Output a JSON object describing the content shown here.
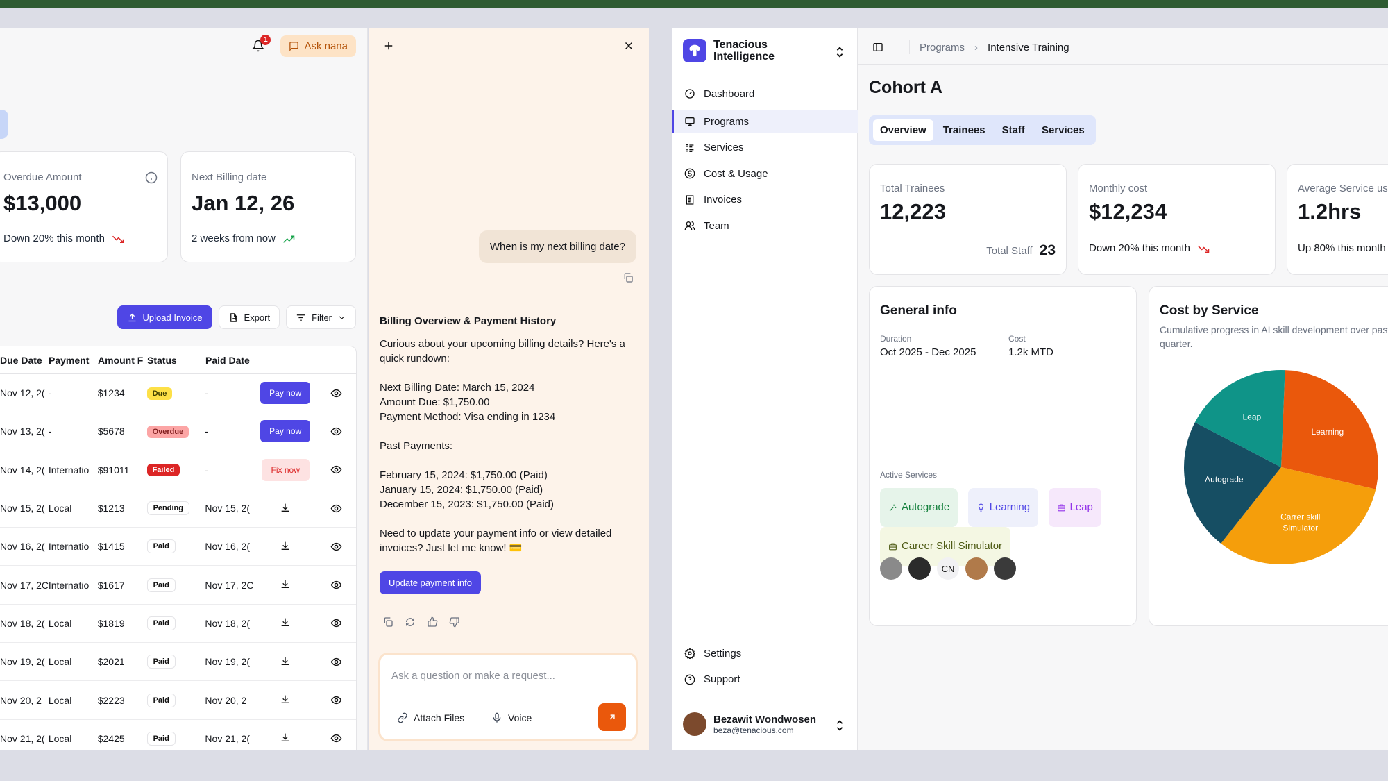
{
  "billing": {
    "notification_count": "1",
    "ask_label": "Ask nana",
    "kpis": [
      {
        "label": "Overdue Amount",
        "value": "$13,000",
        "sub": "Down 20% this month"
      },
      {
        "label": "Next Billing date",
        "value": "Jan 12, 26",
        "sub": "2 weeks from now"
      }
    ],
    "toolbar": {
      "upload": "Upload Invoice",
      "export": "Export",
      "filter": "Filter"
    },
    "columns": [
      "Due Date",
      "Payment",
      "Amount F",
      "Status",
      "Paid Date"
    ],
    "rows": [
      {
        "due": "Nov 12, 2(",
        "payment": "-",
        "amount": "$1234",
        "status": "Due",
        "paid": "-",
        "action": "Pay now"
      },
      {
        "due": "Nov 13, 2(",
        "payment": "-",
        "amount": "$5678",
        "status": "Overdue",
        "paid": "-",
        "action": "Pay now"
      },
      {
        "due": "Nov 14, 2(",
        "payment": "Internatio",
        "amount": "$91011",
        "status": "Failed",
        "paid": "-",
        "action": "Fix now"
      },
      {
        "due": "Nov 15, 2(",
        "payment": "Local",
        "amount": "$1213",
        "status": "Pending",
        "paid": "Nov 15, 2(",
        "action": ""
      },
      {
        "due": "Nov 16, 2(",
        "payment": "Internatio",
        "amount": "$1415",
        "status": "Paid",
        "paid": "Nov 16, 2(",
        "action": ""
      },
      {
        "due": "Nov 17, 2C",
        "payment": "Internatio",
        "amount": "$1617",
        "status": "Paid",
        "paid": "Nov 17, 2C",
        "action": ""
      },
      {
        "due": "Nov 18, 2(",
        "payment": "Local",
        "amount": "$1819",
        "status": "Paid",
        "paid": "Nov 18, 2(",
        "action": ""
      },
      {
        "due": "Nov 19, 2(",
        "payment": "Local",
        "amount": "$2021",
        "status": "Paid",
        "paid": "Nov 19, 2(",
        "action": ""
      },
      {
        "due": "Nov 20, 2",
        "payment": "Local",
        "amount": "$2223",
        "status": "Paid",
        "paid": "Nov 20, 2",
        "action": ""
      },
      {
        "due": "Nov 21, 2(",
        "payment": "Local",
        "amount": "$2425",
        "status": "Paid",
        "paid": "Nov 21, 2(",
        "action": ""
      }
    ]
  },
  "chat": {
    "user_message": "When is my next billing date?",
    "reply_title": "Billing Overview & Payment History",
    "reply_intro": "Curious about your upcoming billing details? Here's a quick rundown:",
    "reply_next_date": "Next Billing Date: March 15, 2024",
    "reply_amount_due": "Amount Due: $1,750.00",
    "reply_method": "Payment Method: Visa ending in 1234",
    "reply_past_title": "Past Payments:",
    "reply_past_1": "February 15, 2024: $1,750.00 (Paid)",
    "reply_past_2": "January 15, 2024: $1,750.00 (Paid)",
    "reply_past_3": "December 15, 2023: $1,750.00 (Paid)",
    "reply_outro": "Need to update your payment info or view detailed invoices? Just let me know! 💳",
    "update_button": "Update payment info",
    "input_placeholder": "Ask a question or make a request...",
    "attach_label": "Attach Files",
    "voice_label": "Voice"
  },
  "sidebar": {
    "brand_line1": "Tenacious",
    "brand_line2": "Intelligence",
    "items": [
      {
        "label": "Dashboard",
        "icon": "dashboard-icon"
      },
      {
        "label": "Programs",
        "icon": "monitor-icon"
      },
      {
        "label": "Services",
        "icon": "list-icon"
      },
      {
        "label": "Cost & Usage",
        "icon": "dollar-icon"
      },
      {
        "label": "Invoices",
        "icon": "document-icon"
      },
      {
        "label": "Team",
        "icon": "users-icon"
      }
    ],
    "bottom_items": [
      {
        "label": "Settings",
        "icon": "gear-icon"
      },
      {
        "label": "Support",
        "icon": "help-icon"
      }
    ],
    "user_name": "Bezawit Wondwosen",
    "user_email": "beza@tenacious.com"
  },
  "main": {
    "breadcrumb": [
      "Programs",
      "Intensive Training"
    ],
    "title": "Cohort A",
    "tabs": [
      "Overview",
      "Trainees",
      "Staff",
      "Services"
    ],
    "stats": [
      {
        "label": "Total Trainees",
        "value": "12,223",
        "extra_label": "Total Staff",
        "extra_value": "23"
      },
      {
        "label": "Monthly cost",
        "value": "$12,234",
        "sub": "Down 20% this month"
      },
      {
        "label": "Average Service us",
        "value": "1.2hrs",
        "sub": "Up 80% this month"
      }
    ],
    "general_info": {
      "title": "General info",
      "duration_label": "Duration",
      "duration_value": "Oct 2025 - Dec 2025",
      "cost_label": "Cost",
      "cost_value": "1.2k MTD",
      "active_services_label": "Active Services",
      "services": [
        "Autograde",
        "Learning",
        "Leap",
        "Career Skill Simulator"
      ],
      "avatar_initials": "CN"
    },
    "cost_by_service": {
      "title": "Cost by Service",
      "subtitle": "Cumulative progress in AI skill development over past quarter."
    }
  },
  "colors": {
    "accent": "#4f46e5",
    "learning": "#ea580c",
    "career": "#f59e0b",
    "leap": "#0f9488",
    "autograde": "#164e63"
  },
  "chart_data": {
    "type": "pie",
    "title": "Cost by Service",
    "subtitle": "Cumulative progress in AI skill development over past quarter.",
    "slices": [
      {
        "label": "Learning",
        "value": 28,
        "color": "#ea580c"
      },
      {
        "label": "Carrer skill Simulator",
        "value": 32,
        "color": "#f59e0b"
      },
      {
        "label": "Autograde",
        "value": 22,
        "color": "#164e63"
      },
      {
        "label": "Leap",
        "value": 18,
        "color": "#0f9488"
      }
    ]
  }
}
